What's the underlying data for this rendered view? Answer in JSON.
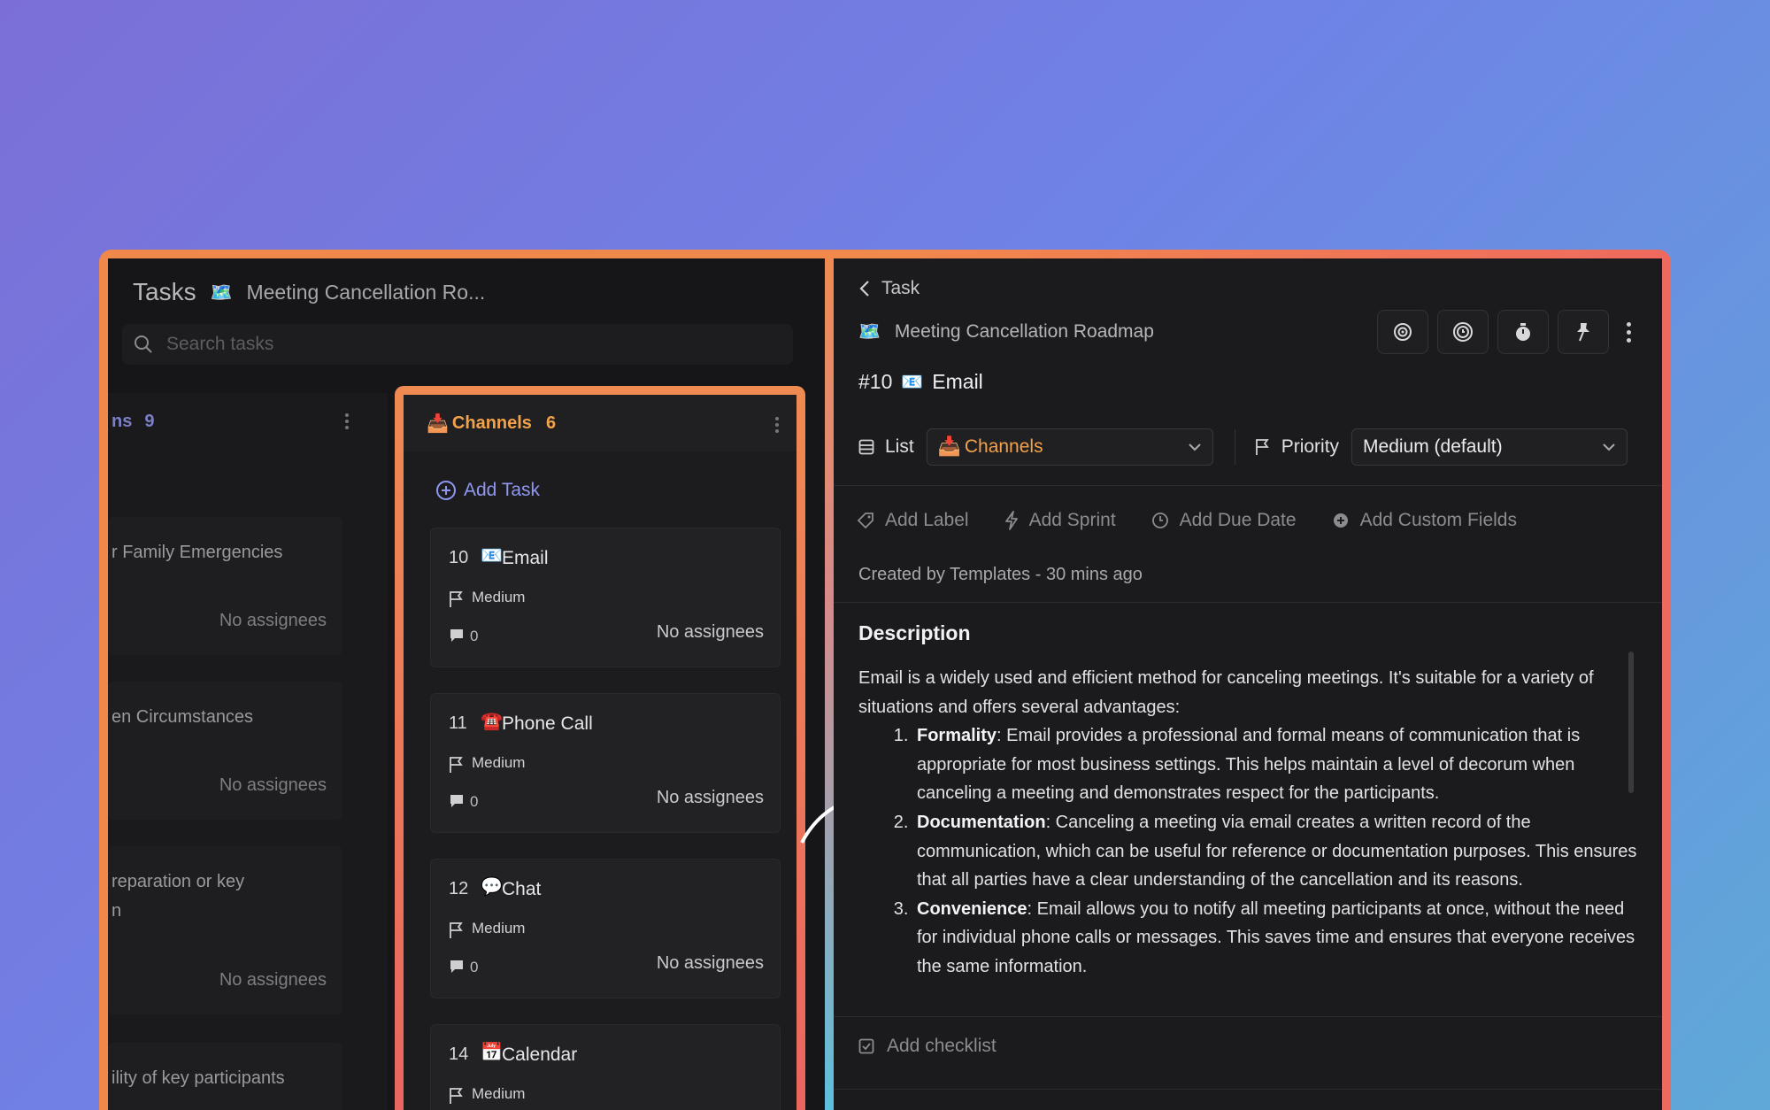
{
  "left": {
    "title": "Tasks",
    "board_icon": "🗺️",
    "board_name": "Meeting Cancellation Ro...",
    "search_placeholder": "Search tasks"
  },
  "col1": {
    "name": "ns",
    "count": "9",
    "cards": [
      {
        "text": "r Family Emergencies",
        "assignees": "No assignees"
      },
      {
        "text": "en Circumstances",
        "assignees": "No assignees"
      },
      {
        "text": "reparation or key\nn",
        "assignees": "No assignees"
      },
      {
        "text": "ility of key participants",
        "assignees": ""
      }
    ]
  },
  "channels": {
    "icon": "📥",
    "name": "Channels",
    "count": "6",
    "add_task": "Add Task",
    "cards": [
      {
        "num": "10",
        "emoji": "📧",
        "title": "Email",
        "priority": "Medium",
        "comments": "0",
        "assignees": "No assignees"
      },
      {
        "num": "11",
        "emoji": "☎️",
        "title": "Phone Call",
        "priority": "Medium",
        "comments": "0",
        "assignees": "No assignees"
      },
      {
        "num": "12",
        "emoji": "💬",
        "title": "Chat",
        "priority": "Medium",
        "comments": "0",
        "assignees": "No assignees"
      },
      {
        "num": "14",
        "emoji": "📅",
        "title": "Calendar",
        "priority": "Medium",
        "comments": "",
        "assignees": ""
      }
    ]
  },
  "detail": {
    "back_label": "Task",
    "board_icon": "🗺️",
    "board_name": "Meeting Cancellation Roadmap",
    "task_id": "#10",
    "task_emoji": "📧",
    "task_title": "Email",
    "list_label": "List",
    "list_icon": "📥",
    "list_value": "Channels",
    "priority_label": "Priority",
    "priority_value": "Medium (default)",
    "add_label": "Add Label",
    "add_sprint": "Add Sprint",
    "add_due_date": "Add Due Date",
    "add_custom_fields": "Add Custom Fields",
    "created": "Created by Templates - 30 mins ago",
    "description_heading": "Description",
    "description_intro": "Email is a widely used and efficient method for canceling meetings. It's suitable for a variety of situations and offers several advantages:",
    "points": [
      {
        "term": "Formality",
        "text": ": Email provides a professional and formal means of communication that is appropriate for most business settings. This helps maintain a level of decorum when canceling a meeting and demonstrates respect for the participants."
      },
      {
        "term": "Documentation",
        "text": ": Canceling a meeting via email creates a written record of the communication, which can be useful for reference or documentation purposes. This ensures that all parties have a clear understanding of the cancellation and its reasons."
      },
      {
        "term": "Convenience",
        "text": ": Email allows you to notify all meeting participants at once, without the need for individual phone calls or messages. This saves time and ensures that everyone receives the same information."
      }
    ],
    "add_checklist": "Add checklist"
  },
  "colors": {
    "accent_orange": "#f2a24a",
    "accent_purple": "#8f97f0",
    "frame_orange": "#f0884a",
    "frame_red": "#ef6a5e"
  }
}
